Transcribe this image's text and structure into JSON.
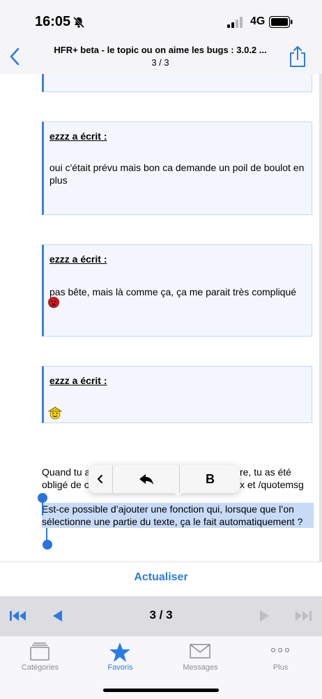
{
  "status_bar": {
    "time": "16:05",
    "network": "4G"
  },
  "nav": {
    "title": "HFR+ beta - le topic ou on aime les bugs : 3.0.2 ...",
    "subtitle": "3 / 3"
  },
  "quotes": [
    {
      "author": "ezzz a écrit :",
      "text": "oui c'était prévu mais bon ca demande un poil de boulot en plus"
    },
    {
      "author": "ezzz a écrit :",
      "text": "pas bête, mais là comme ça, ça me parait très compliqué"
    },
    {
      "author": "ezzz a écrit :",
      "text": ""
    }
  ],
  "post": {
    "line1_start": "Quand tu a",
    "line1_end": "re, tu as été",
    "line2_start": "obligé de c",
    "line2_end": "x et /quotemsg",
    "selected": "Est-ce possible d’ajouter une fonction qui, lorsque que l’on sélectionne une partie du texte, ça le fait automatiquement ?"
  },
  "context_menu": {
    "bold_label": "B"
  },
  "refresh": {
    "label": "Actualiser"
  },
  "pager": {
    "indicator": "3 / 3"
  },
  "tabs": [
    {
      "label": "Catégories",
      "icon": "folder-icon",
      "active": false
    },
    {
      "label": "Favoris",
      "icon": "star-icon",
      "active": true
    },
    {
      "label": "Messages",
      "icon": "envelope-icon",
      "active": false
    },
    {
      "label": "Plus",
      "icon": "more-icon",
      "active": false
    }
  ],
  "colors": {
    "accent": "#2a7de1",
    "quote_border": "#3f7fd9",
    "selection": "#c8dbf6",
    "inactive_tab": "#8e8e93"
  }
}
